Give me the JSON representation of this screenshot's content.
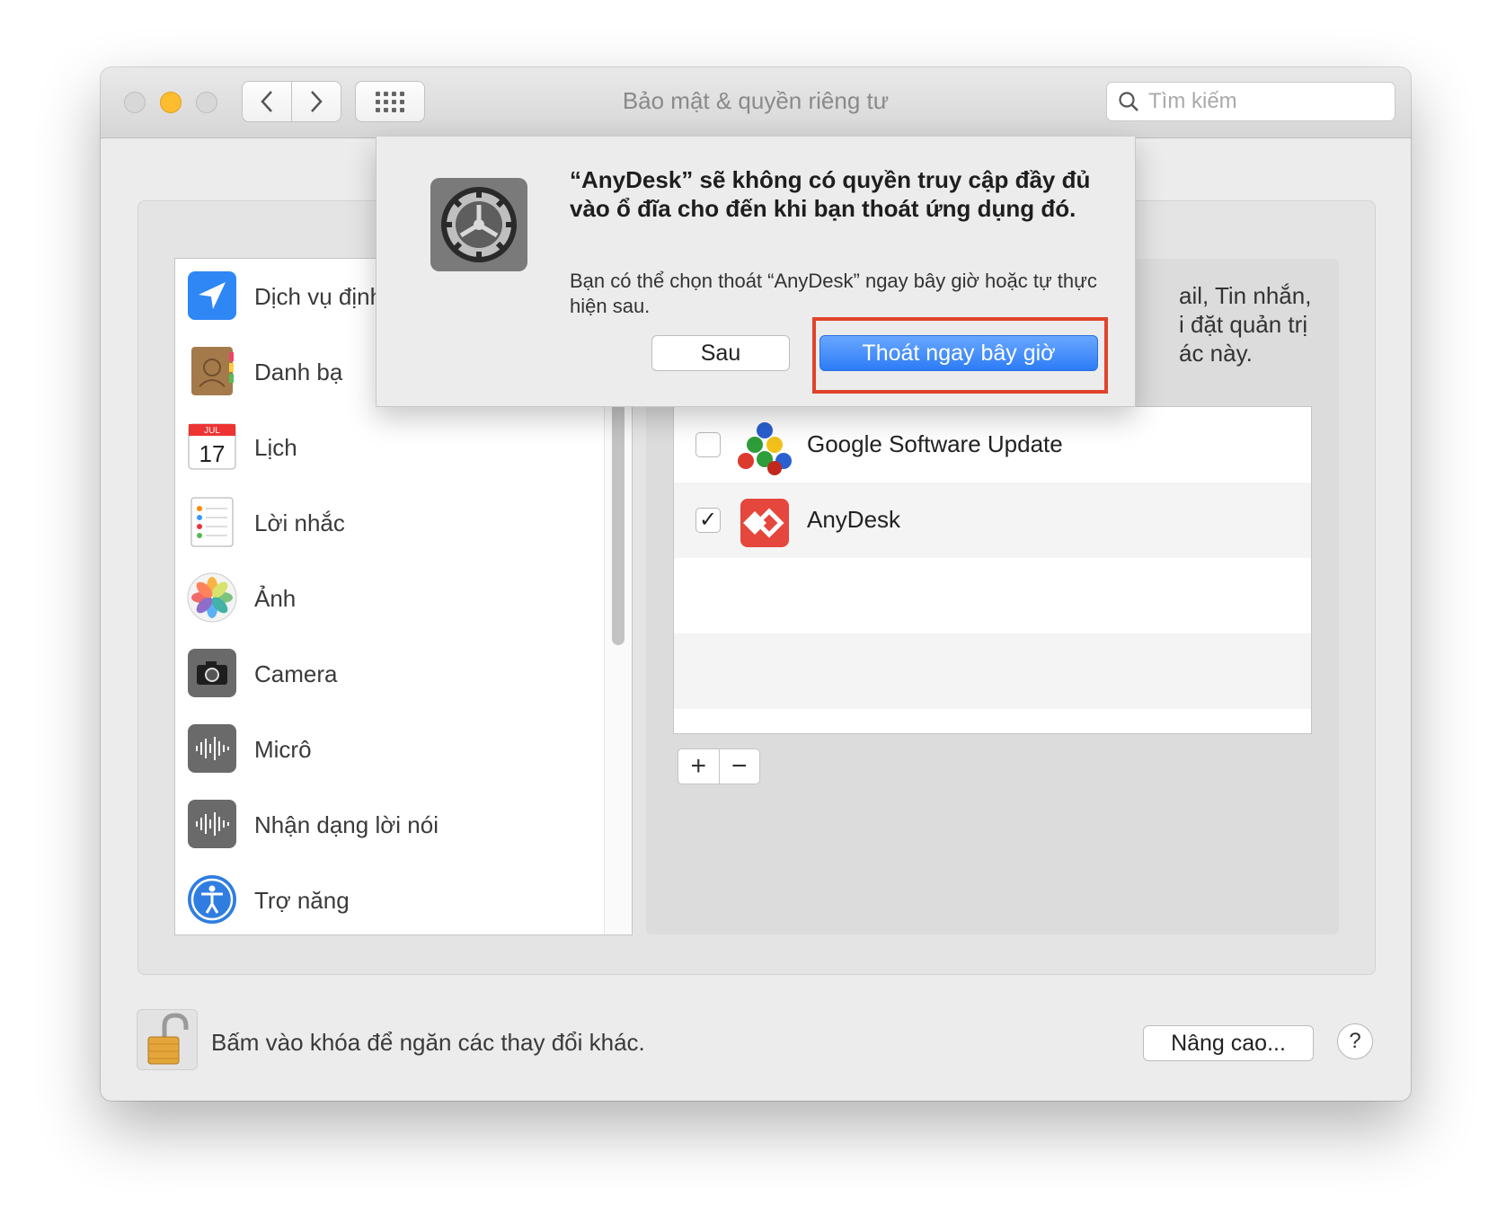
{
  "window": {
    "title": "Bảo mật & quyền riêng tư",
    "search_placeholder": "Tìm kiếm"
  },
  "icons": {
    "back": "chevron-left-icon",
    "forward": "chevron-right-icon",
    "grid": "grid-icon",
    "search": "search-icon"
  },
  "categories": [
    {
      "label": "Dịch vụ định vị",
      "icon": "location-icon"
    },
    {
      "label": "Danh bạ",
      "icon": "contacts-icon"
    },
    {
      "label": "Lịch",
      "icon": "calendar-icon",
      "calendar_month": "JUL",
      "calendar_day": "17"
    },
    {
      "label": "Lời nhắc",
      "icon": "reminders-icon"
    },
    {
      "label": "Ảnh",
      "icon": "photos-icon"
    },
    {
      "label": "Camera",
      "icon": "camera-icon"
    },
    {
      "label": "Micrô",
      "icon": "microphone-icon"
    },
    {
      "label": "Nhận dạng lời nói",
      "icon": "speech-recognition-icon"
    },
    {
      "label": "Trợ năng",
      "icon": "accessibility-icon"
    }
  ],
  "right_panel": {
    "description_lines": [
      "ail, Tin nhắn,",
      "i đặt quản trị",
      "ác này."
    ],
    "apps": [
      {
        "name": "Google Software Update",
        "checked": false,
        "icon": "google-software-update-icon"
      },
      {
        "name": "AnyDesk",
        "checked": true,
        "icon": "anydesk-icon"
      }
    ],
    "add_label": "+",
    "remove_label": "−"
  },
  "bottom": {
    "lock_text": "Bấm vào khóa để ngăn các thay đổi khác.",
    "advanced_label": "Nâng cao...",
    "help_label": "?"
  },
  "dialog": {
    "title": "“AnyDesk” sẽ không có quyền truy cập đầy đủ vào ổ đĩa cho đến khi bạn thoát ứng dụng đó.",
    "message": "Bạn có thể chọn thoát “AnyDesk” ngay bây giờ hoặc tự thực hiện sau.",
    "later_label": "Sau",
    "quit_label": "Thoát ngay bây giờ"
  },
  "colors": {
    "accent_blue": "#2c7cf6",
    "highlight_red": "#e0432b",
    "traffic_min": "#febd2e"
  }
}
